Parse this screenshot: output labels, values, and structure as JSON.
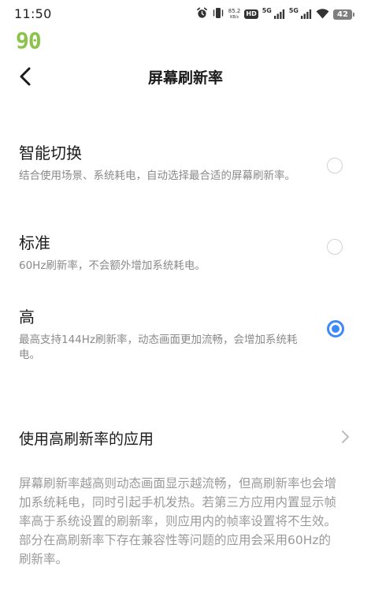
{
  "status_bar": {
    "time": "11:50",
    "net_speed_value": "85.2",
    "net_speed_unit": "KB/s",
    "hd_label": "HD",
    "sim1_label": "5G",
    "sim2_label": "5G",
    "battery": "42",
    "icons": [
      "alarm-icon",
      "vibrate-icon",
      "hd-volte-icon",
      "signal-icon",
      "wifi-icon",
      "battery-icon"
    ]
  },
  "overlay": {
    "fps": "90"
  },
  "header": {
    "title": "屏幕刷新率",
    "back_icon": "chevron-left-icon"
  },
  "options": [
    {
      "title": "智能切换",
      "description": "结合使用场景、系统耗电，自动选择最合适的屏幕刷新率。",
      "selected": false
    },
    {
      "title": "标准",
      "description": "60Hz刷新率，不会额外增加系统耗电。",
      "selected": false
    },
    {
      "title": "高",
      "description": "最高支持144Hz刷新率，动态画面更加流畅，会增加系统耗电。",
      "selected": true
    }
  ],
  "apps_row": {
    "label": "使用高刷新率的应用",
    "icon": "chevron-right-icon"
  },
  "footnote": "屏幕刷新率越高则动态画面显示越流畅，但高刷新率也会增加系统耗电，同时引起手机发热。若第三方应用内置显示帧率高于系统设置的刷新率，则应用内的帧率设置将不生效。部分在高刷新率下存在兼容性等问题的应用会采用60Hz的刷新率。",
  "colors": {
    "accent": "#3d8af7",
    "fps_overlay": "#8bc34a",
    "secondary_text": "#8a8a8a",
    "radio_unchecked": "#d2d2d2"
  }
}
